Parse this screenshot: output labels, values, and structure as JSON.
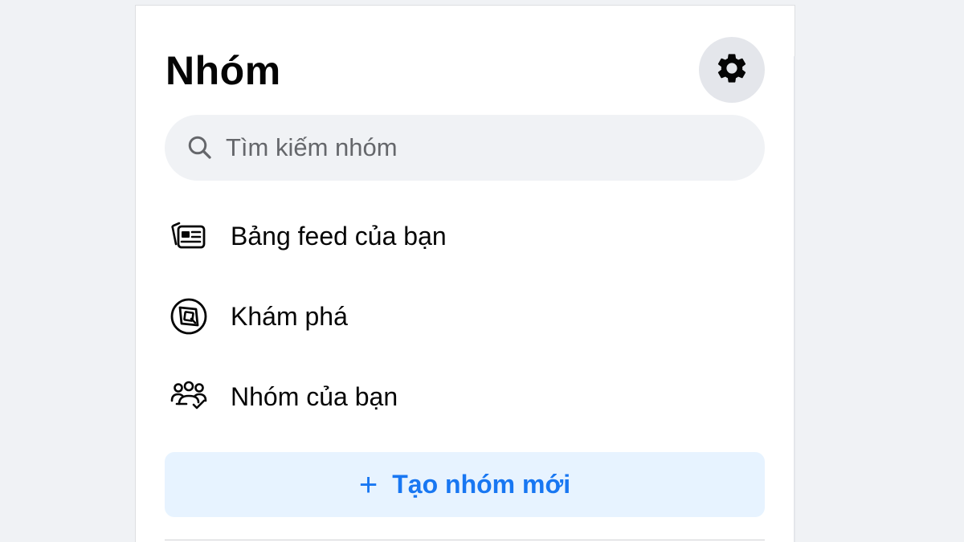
{
  "header": {
    "title": "Nhóm"
  },
  "settings": {
    "icon": "gear-icon"
  },
  "search": {
    "placeholder": "Tìm kiếm nhóm",
    "value": "",
    "icon": "search-icon"
  },
  "nav": {
    "items": [
      {
        "label": "Bảng feed của bạn",
        "icon": "feed-icon"
      },
      {
        "label": "Khám phá",
        "icon": "discover-icon"
      },
      {
        "label": "Nhóm của bạn",
        "icon": "your-groups-icon"
      }
    ]
  },
  "create": {
    "label": "Tạo nhóm mới",
    "icon": "plus-icon",
    "symbol": "+"
  },
  "colors": {
    "background": "#f0f2f5",
    "panel": "#ffffff",
    "accent": "#1877f2",
    "create_bg": "#e7f3ff",
    "text": "#050505",
    "secondary_text": "#65676b"
  }
}
